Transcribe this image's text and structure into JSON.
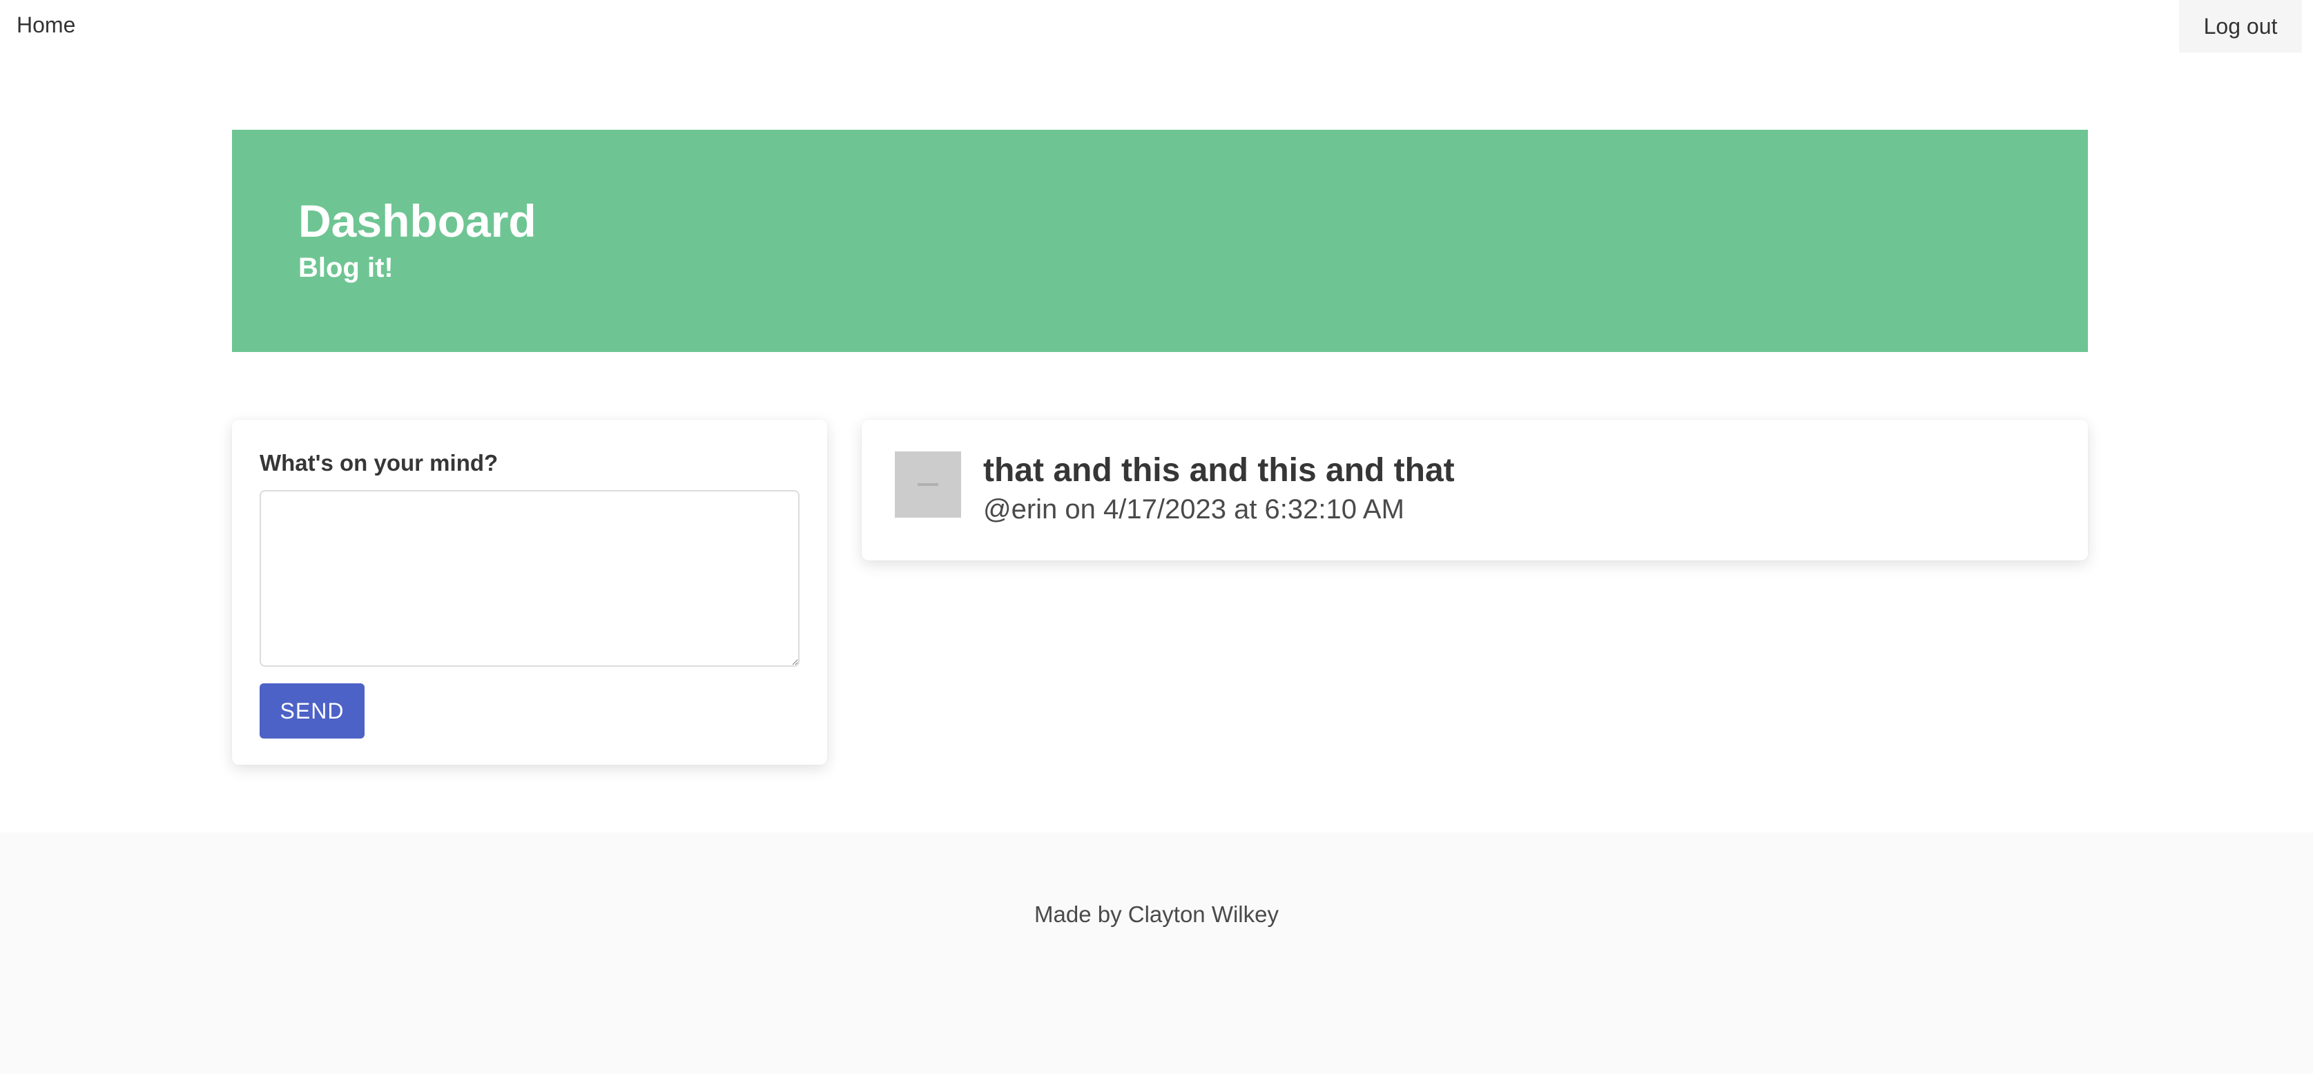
{
  "nav": {
    "home_label": "Home",
    "logout_label": "Log out"
  },
  "hero": {
    "title": "Dashboard",
    "subtitle": "Blog it!",
    "color": "#6ec593"
  },
  "post_form": {
    "label": "What's on your mind?",
    "textarea_value": "",
    "send_label": "SEND",
    "send_color": "#4d62c6"
  },
  "posts": [
    {
      "title": "that and this and this and that",
      "meta": "@erin on 4/17/2023 at 6:32:10 AM",
      "avatar_icon": "avatar-icon"
    }
  ],
  "footer": {
    "text": "Made by Clayton Wilkey"
  }
}
